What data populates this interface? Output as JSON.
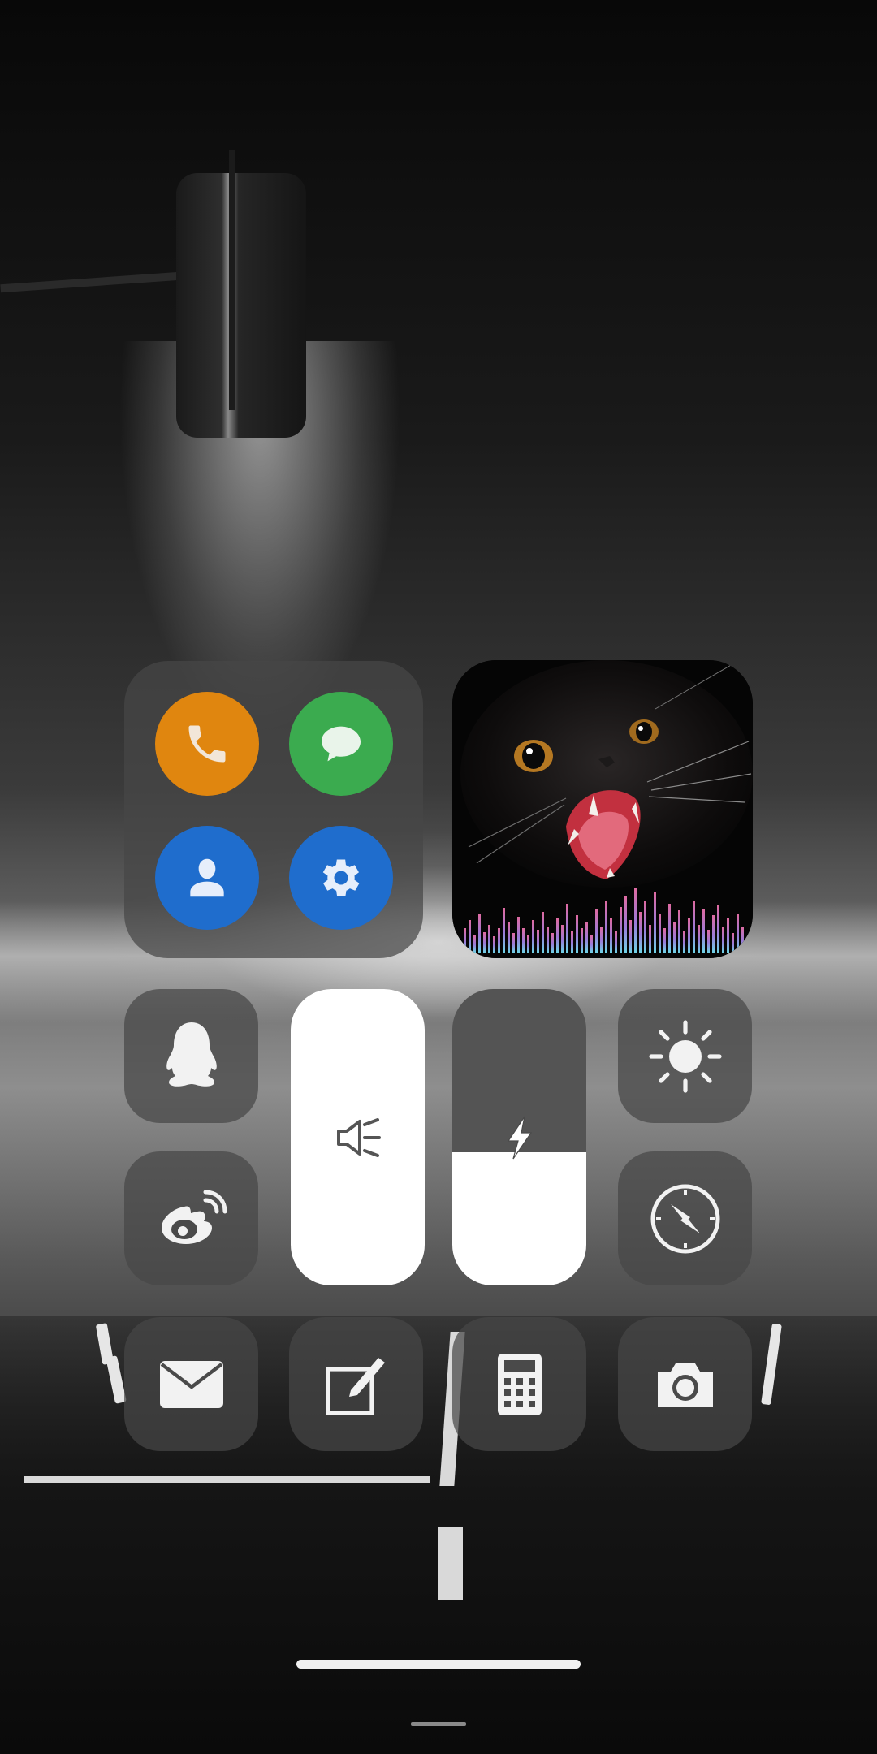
{
  "colors": {
    "phone": "#e0860f",
    "messages": "#3bab4f",
    "contacts": "#1f6dcd",
    "settings": "#1f6dcd",
    "tile": "#464646",
    "slider_fill": "#ffffff"
  },
  "quick_apps": [
    {
      "name": "phone",
      "icon": "phone-icon"
    },
    {
      "name": "messages",
      "icon": "chat-bubble-icon"
    },
    {
      "name": "contacts",
      "icon": "person-icon"
    },
    {
      "name": "settings",
      "icon": "gear-icon"
    }
  ],
  "media_tile": {
    "artwork": "black-cat-artwork",
    "visualizer": "audio-equalizer-bars"
  },
  "controls": {
    "qq": {
      "icon": "penguin-icon"
    },
    "weibo": {
      "icon": "weibo-eye-icon"
    },
    "flashlight_slider": {
      "icon": "flashlight-icon",
      "level": 1.0
    },
    "brightness_slider": {
      "icon": "lightning-icon",
      "level": 0.45
    },
    "display_brightness": {
      "icon": "sun-icon"
    },
    "compass": {
      "icon": "compass-icon"
    }
  },
  "bottom_apps": [
    {
      "name": "mail",
      "icon": "mail-icon"
    },
    {
      "name": "notes",
      "icon": "note-edit-icon"
    },
    {
      "name": "calculator",
      "icon": "calculator-icon"
    },
    {
      "name": "camera",
      "icon": "camera-icon"
    }
  ]
}
